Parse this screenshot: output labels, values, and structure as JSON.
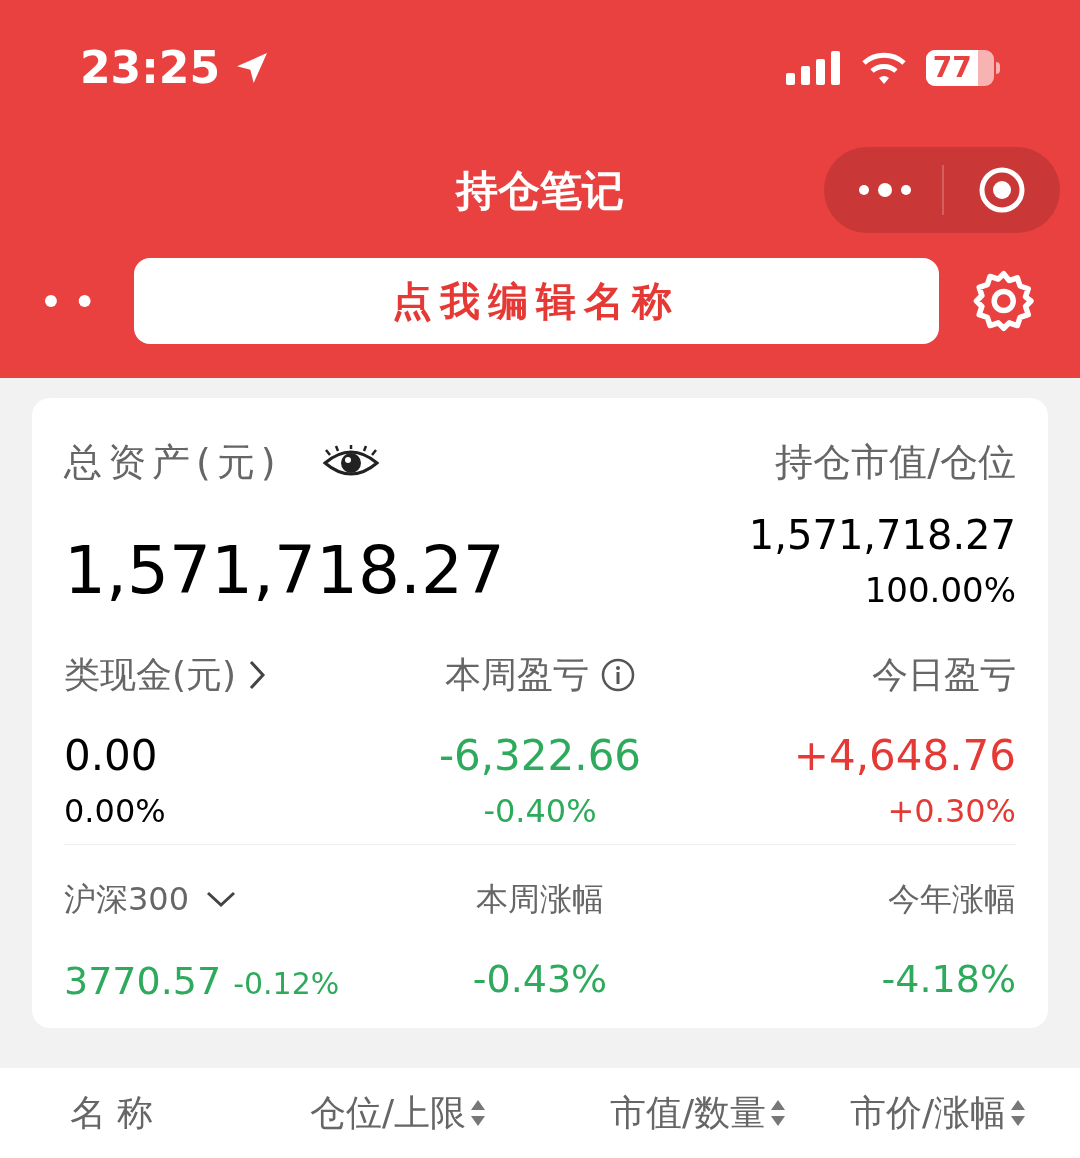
{
  "status_bar": {
    "time": "23:25",
    "battery": "77"
  },
  "nav": {
    "title": "持仓笔记"
  },
  "name_button": {
    "label": "点我编辑名称"
  },
  "summary": {
    "total_label": "总资产(元)",
    "total_value": "1,571,718.27",
    "position_label": "持仓市值/仓位",
    "position_value": "1,571,718.27",
    "position_pct": "100.00%"
  },
  "stats": [
    {
      "kind": "link",
      "label": "类现金(元)",
      "value": "0.00",
      "pct": "0.00%",
      "color": "#000000"
    },
    {
      "kind": "info",
      "label": "本周盈亏",
      "value": "-6,322.66",
      "pct": "-0.40%",
      "color": "#2eaa5c"
    },
    {
      "kind": "plain",
      "label": "今日盈亏",
      "value": "+4,648.76",
      "pct": "+0.30%",
      "color": "#e53935"
    }
  ],
  "index": {
    "name": "沪深300",
    "value": "3770.57",
    "change": "-0.12%",
    "color": "#2eaa5c",
    "periods": [
      {
        "label": "本周涨幅",
        "value": "-0.43%",
        "color": "#2eaa5c"
      },
      {
        "label": "今年涨幅",
        "value": "-4.18%",
        "color": "#2eaa5c"
      }
    ]
  },
  "table": {
    "columns": [
      {
        "label": "名 称",
        "sortable": false
      },
      {
        "label": "仓位/上限",
        "sortable": true
      },
      {
        "label": "市值/数量",
        "sortable": true
      },
      {
        "label": "市价/涨幅",
        "sortable": true
      }
    ]
  }
}
